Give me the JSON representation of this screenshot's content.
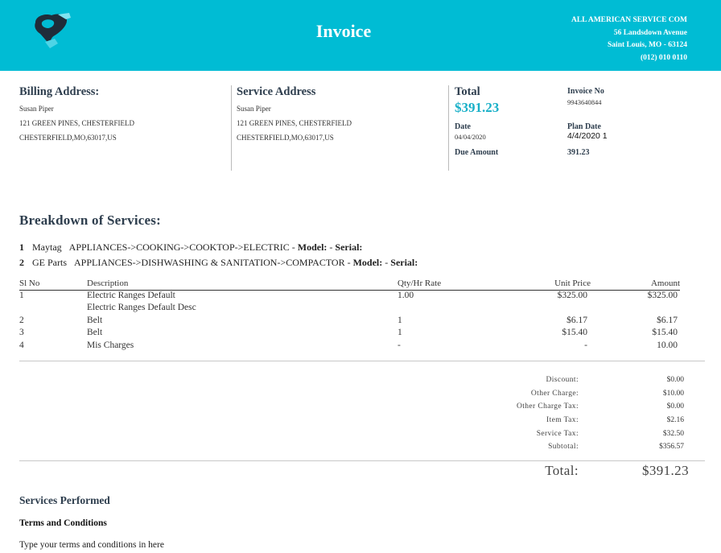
{
  "header": {
    "title": "Invoice",
    "company_name": "ALL AMERICAN SERVICE COM",
    "company_street": "56 Landsdown Avenue",
    "company_city": "Saint Louis, MO - 63124",
    "company_phone": "(012) 010 0110",
    "brand_color": "#00bcd4",
    "logo_icon": "map-pin-logo-icon"
  },
  "billing": {
    "label": "Billing Address:",
    "name": "Susan Piper",
    "line1": "121 GREEN PINES, CHESTERFIELD",
    "line2": "CHESTERFIELD,MO,63017,US"
  },
  "service_address": {
    "label": "Service Address",
    "name": "Susan Piper",
    "line1": "121 GREEN PINES, CHESTERFIELD",
    "line2": "CHESTERFIELD,MO,63017,US"
  },
  "summary": {
    "total_label": "Total",
    "total_value": "$391.23",
    "invoice_no_label": "Invoice No",
    "invoice_no": "9943640844",
    "date_label": "Date",
    "date": "04/04/2020",
    "plan_date_label": "Plan Date",
    "plan_date": "4/4/2020 1",
    "due_label": "Due Amount",
    "due_value": "391.23"
  },
  "breakdown": {
    "title": "Breakdown of Services:",
    "services": [
      {
        "num": "1",
        "brand": "Maytag",
        "path": "APPLIANCES->COOKING->COOKTOP->ELECTRIC",
        "sep": " - ",
        "model_label": "Model:",
        "dash": " - ",
        "serial_label": "Serial:"
      },
      {
        "num": "2",
        "brand": "GE Parts",
        "path": "APPLIANCES->DISHWASHING & SANITATION->COMPACTOR",
        "sep": " - ",
        "model_label": "Model:",
        "dash": " - ",
        "serial_label": "Serial:"
      }
    ]
  },
  "table": {
    "headers": {
      "sl": "Sl No",
      "desc": "Description",
      "qty": "Qty/Hr Rate",
      "unit": "Unit Price",
      "amount": "Amount"
    },
    "rows": [
      {
        "sl": "1",
        "desc": "Electric Ranges Default",
        "subdesc": "Electric Ranges Default Desc",
        "qty": "1.00",
        "unit": "$325.00",
        "amount": "$325.00"
      },
      {
        "sl": "2",
        "desc": "Belt",
        "qty": "1",
        "unit": "$6.17",
        "amount": "$6.17"
      },
      {
        "sl": "3",
        "desc": "Belt",
        "qty": "1",
        "unit": "$15.40",
        "amount": "$15.40"
      },
      {
        "sl": "4",
        "desc": "Mis Charges",
        "qty": "-",
        "unit": "-",
        "amount": "10.00"
      }
    ]
  },
  "totals": {
    "lines": [
      {
        "label": "Discount:",
        "value": "$0.00"
      },
      {
        "label": "Other Charge:",
        "value": "$10.00"
      },
      {
        "label": "Other Charge Tax:",
        "value": "$0.00"
      },
      {
        "label": "Item Tax:",
        "value": "$2.16"
      },
      {
        "label": "Service Tax:",
        "value": "$32.50"
      },
      {
        "label": "Subtotal:",
        "value": "$356.57"
      }
    ],
    "grand_label": "Total:",
    "grand_value": "$391.23"
  },
  "footer": {
    "services_performed": "Services Performed",
    "terms_title": "Terms and Conditions",
    "terms_text": "Type your terms and conditions in here"
  }
}
